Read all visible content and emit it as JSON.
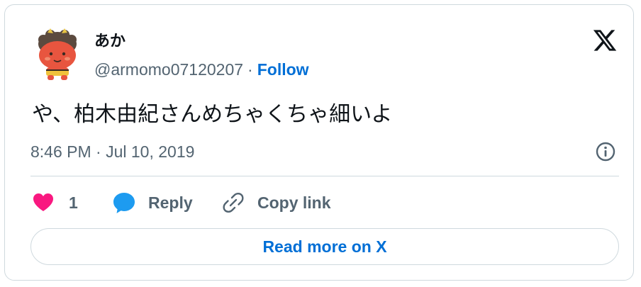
{
  "user": {
    "display_name": "あか",
    "handle": "@armomo07120207",
    "separator": "·",
    "follow_label": "Follow",
    "avatar_icon": "red-oni-icon"
  },
  "brand": {
    "logo_icon": "x-logo-icon"
  },
  "tweet": {
    "text": "や、柏木由紀さんめちゃくちゃ細いよ",
    "timestamp": "8:46 PM · Jul 10, 2019"
  },
  "actions": {
    "like_count": "1",
    "reply_label": "Reply",
    "copy_link_label": "Copy link"
  },
  "read_more_label": "Read more on X",
  "colors": {
    "accent": "#006fd6",
    "text_primary": "#0f1419",
    "text_secondary": "#536471",
    "border": "#cfd9de",
    "like": "#f91880",
    "reply": "#1d9bf0",
    "avatar_face": "#e8553f"
  }
}
